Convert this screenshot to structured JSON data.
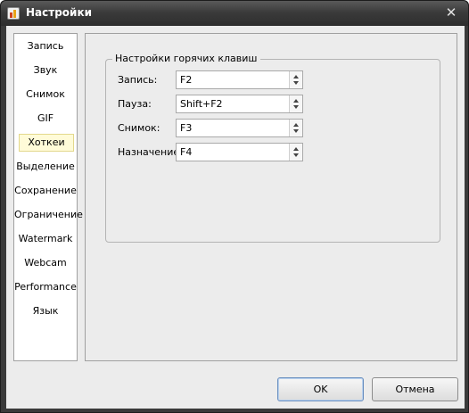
{
  "window": {
    "title": "Настройки",
    "close_glyph": "✕"
  },
  "sidebar": {
    "items": [
      {
        "label": "Запись"
      },
      {
        "label": "Звук"
      },
      {
        "label": "Снимок"
      },
      {
        "label": "GIF"
      },
      {
        "label": "Хоткеи",
        "selected": true
      },
      {
        "label": "Выделение"
      },
      {
        "label": "Сохранение"
      },
      {
        "label": "Ограничение"
      },
      {
        "label": "Watermark"
      },
      {
        "label": "Webcam"
      },
      {
        "label": "Performance"
      },
      {
        "label": "Язык"
      }
    ]
  },
  "hotkeys": {
    "group_title": "Настройки горячих клавиш",
    "rows": [
      {
        "label": "Запись:",
        "value": "F2"
      },
      {
        "label": "Пауза:",
        "value": "Shift+F2"
      },
      {
        "label": "Снимок:",
        "value": "F3"
      },
      {
        "label": "Назначение:",
        "value": "F4"
      }
    ]
  },
  "buttons": {
    "ok": "OK",
    "cancel": "Отмена"
  },
  "colors": {
    "titlebar": "#3b3b3b",
    "selected_item_bg": "#fffbd8",
    "dialog_bg": "#ececec"
  }
}
